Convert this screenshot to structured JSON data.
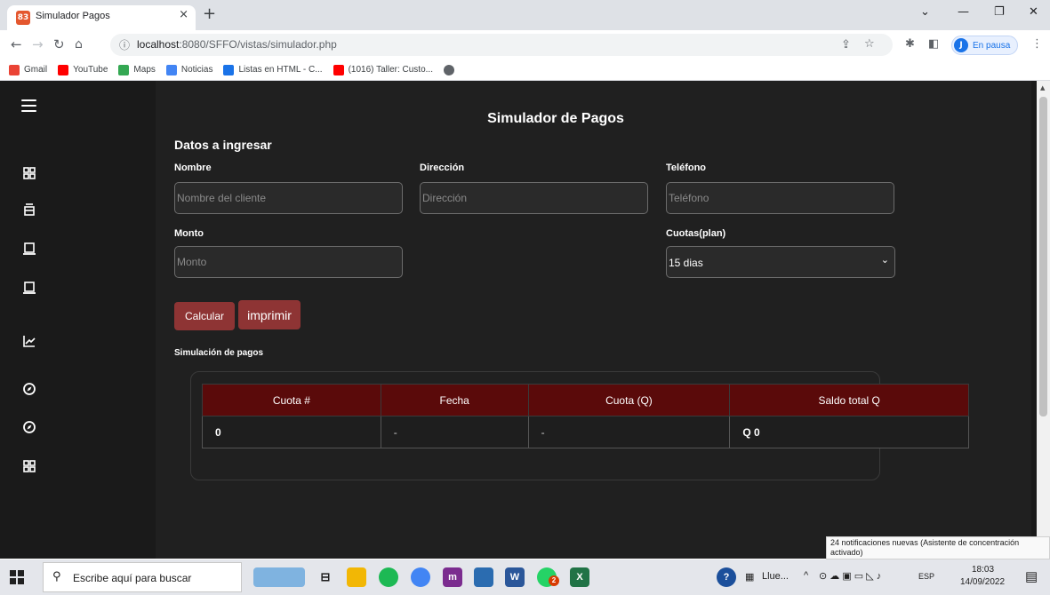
{
  "browser": {
    "tab_title": "Simulador Pagos",
    "tab_close": "×",
    "new_tab": "+",
    "url_host": "localhost",
    "url_rest": ":8080/SFFO/vistas/simulador.php",
    "profile_initial": "J",
    "profile_status": "En pausa",
    "bookmarks": [
      {
        "label": "Gmail",
        "color": "#ea4335"
      },
      {
        "label": "YouTube",
        "color": "#ff0000"
      },
      {
        "label": "Maps",
        "color": "#34a853"
      },
      {
        "label": "Noticias",
        "color": "#4285f4"
      },
      {
        "label": "Listas en HTML - C...",
        "color": "#1a73e8"
      },
      {
        "label": "(1016) Taller: Custo...",
        "color": "#ff0000"
      }
    ]
  },
  "page": {
    "title": "Simulador de Pagos",
    "section_title": "Datos a ingresar",
    "fields": {
      "nombre": {
        "label": "Nombre",
        "placeholder": "Nombre del cliente"
      },
      "direccion": {
        "label": "Dirección",
        "placeholder": "Dirección"
      },
      "telefono": {
        "label": "Teléfono",
        "placeholder": "Teléfono"
      },
      "monto": {
        "label": "Monto",
        "placeholder": "Monto"
      },
      "cuotas": {
        "label": "Cuotas(plan)",
        "selected": "15 dias"
      }
    },
    "buttons": {
      "calcular": "Calcular",
      "imprimir": "imprimir"
    },
    "simulation_title": "Simulación de pagos",
    "table": {
      "headers": [
        "Cuota #",
        "Fecha",
        "Cuota (Q)",
        "Saldo total Q"
      ],
      "row": [
        "0",
        "-",
        "-",
        "Q 0"
      ]
    },
    "colors": {
      "header_bg": "#5a0a0a",
      "button_bg": "#8e3434",
      "page_bg": "#202020"
    }
  },
  "sidebar": {
    "icons": [
      "menu-icon",
      "dashboard-icon",
      "inbox-icon",
      "laptop-icon",
      "laptop-icon",
      "chart-icon",
      "compass-icon",
      "compass-icon",
      "dashboard-icon"
    ]
  },
  "notification": {
    "text": "24 notificaciones nuevas (Asistente de concentración activado)"
  },
  "taskbar": {
    "search_placeholder": "Escribe aquí para buscar",
    "weather_text": "Llue...",
    "language": "ESP",
    "time": "18:03",
    "date": "14/09/2022",
    "app_badge": "2"
  }
}
